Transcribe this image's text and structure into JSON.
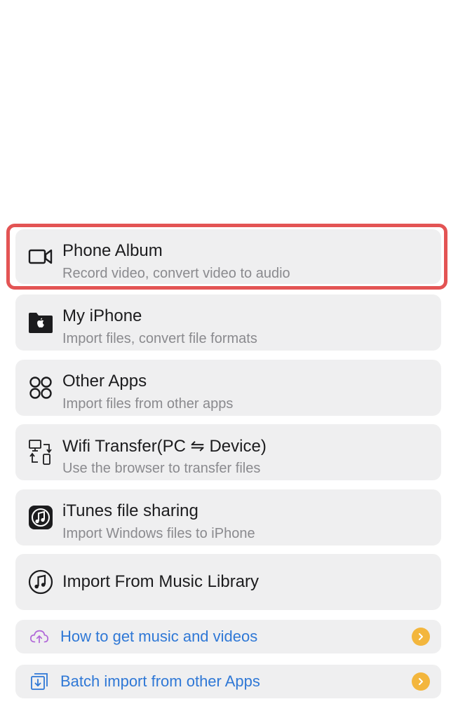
{
  "options": [
    {
      "title": "Phone Album",
      "subtitle": "Record video, convert video to audio",
      "icon": "video-camera-icon"
    },
    {
      "title": "My iPhone",
      "subtitle": "Import files, convert file formats",
      "icon": "apple-folder-icon"
    },
    {
      "title": "Other Apps",
      "subtitle": "Import files from other apps",
      "icon": "command-icon"
    },
    {
      "title": "Wifi Transfer(PC ⇋ Device)",
      "subtitle": "Use the browser to transfer files",
      "icon": "wifi-transfer-icon"
    },
    {
      "title": "iTunes file sharing",
      "subtitle": "Import Windows files to iPhone",
      "icon": "itunes-icon"
    },
    {
      "title": "Import From Music Library",
      "icon": "music-note-icon"
    }
  ],
  "links": [
    {
      "label": "How to get music and videos",
      "icon": "cloud-icon"
    },
    {
      "label": "Batch import from other Apps",
      "icon": "batch-import-icon"
    }
  ],
  "colors": {
    "highlight": "#e35454",
    "link_text": "#2f78d6",
    "chevron_badge": "#f3b63d",
    "card_background": "#efeff0"
  }
}
